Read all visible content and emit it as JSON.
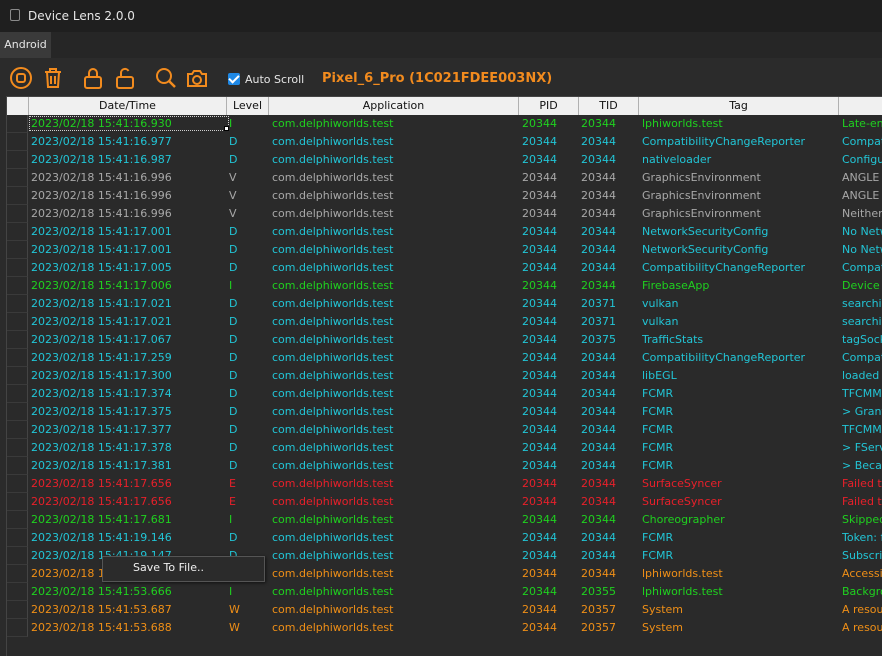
{
  "window": {
    "title": "Device Lens 2.0.0"
  },
  "tabs": [
    {
      "label": "Android"
    }
  ],
  "toolbar": {
    "icons": [
      "stop-icon",
      "trash-icon",
      "lock-icon",
      "unlock-icon",
      "search-icon",
      "camera-icon"
    ],
    "auto_scroll_label": "Auto Scroll",
    "auto_scroll_checked": true,
    "device_label": "Pixel_6_Pro (1C021FDEE003NX)"
  },
  "colors": {
    "I": "#1fd11f",
    "D": "#22c5d6",
    "V": "#a8a8a8",
    "E": "#e8202a",
    "W": "#ef8f17",
    "accent": "#f28b1e"
  },
  "table": {
    "columns": [
      "Date/Time",
      "Level",
      "Application",
      "PID",
      "TID",
      "Tag"
    ],
    "rows": [
      {
        "datetime": "2023/02/18 15:41:16.930",
        "level": "I",
        "app": "com.delphiworlds.test",
        "pid": "20344",
        "tid": "20344",
        "tag": "lphiworlds.test",
        "msg": "Late-en"
      },
      {
        "datetime": "2023/02/18 15:41:16.977",
        "level": "D",
        "app": "com.delphiworlds.test",
        "pid": "20344",
        "tid": "20344",
        "tag": "CompatibilityChangeReporter",
        "msg": "Compat"
      },
      {
        "datetime": "2023/02/18 15:41:16.987",
        "level": "D",
        "app": "com.delphiworlds.test",
        "pid": "20344",
        "tid": "20344",
        "tag": "nativeloader",
        "msg": "Configu"
      },
      {
        "datetime": "2023/02/18 15:41:16.996",
        "level": "V",
        "app": "com.delphiworlds.test",
        "pid": "20344",
        "tid": "20344",
        "tag": "GraphicsEnvironment",
        "msg": "ANGLE"
      },
      {
        "datetime": "2023/02/18 15:41:16.996",
        "level": "V",
        "app": "com.delphiworlds.test",
        "pid": "20344",
        "tid": "20344",
        "tag": "GraphicsEnvironment",
        "msg": "ANGLE"
      },
      {
        "datetime": "2023/02/18 15:41:16.996",
        "level": "V",
        "app": "com.delphiworlds.test",
        "pid": "20344",
        "tid": "20344",
        "tag": "GraphicsEnvironment",
        "msg": "Neither"
      },
      {
        "datetime": "2023/02/18 15:41:17.001",
        "level": "D",
        "app": "com.delphiworlds.test",
        "pid": "20344",
        "tid": "20344",
        "tag": "NetworkSecurityConfig",
        "msg": "No Netw"
      },
      {
        "datetime": "2023/02/18 15:41:17.001",
        "level": "D",
        "app": "com.delphiworlds.test",
        "pid": "20344",
        "tid": "20344",
        "tag": "NetworkSecurityConfig",
        "msg": "No Netw"
      },
      {
        "datetime": "2023/02/18 15:41:17.005",
        "level": "D",
        "app": "com.delphiworlds.test",
        "pid": "20344",
        "tid": "20344",
        "tag": "CompatibilityChangeReporter",
        "msg": "Compat"
      },
      {
        "datetime": "2023/02/18 15:41:17.006",
        "level": "I",
        "app": "com.delphiworlds.test",
        "pid": "20344",
        "tid": "20344",
        "tag": "FirebaseApp",
        "msg": "Device u"
      },
      {
        "datetime": "2023/02/18 15:41:17.021",
        "level": "D",
        "app": "com.delphiworlds.test",
        "pid": "20344",
        "tid": "20371",
        "tag": "vulkan",
        "msg": "searchin"
      },
      {
        "datetime": "2023/02/18 15:41:17.021",
        "level": "D",
        "app": "com.delphiworlds.test",
        "pid": "20344",
        "tid": "20371",
        "tag": "vulkan",
        "msg": "searchin"
      },
      {
        "datetime": "2023/02/18 15:41:17.067",
        "level": "D",
        "app": "com.delphiworlds.test",
        "pid": "20344",
        "tid": "20375",
        "tag": "TrafficStats",
        "msg": "tagSock"
      },
      {
        "datetime": "2023/02/18 15:41:17.259",
        "level": "D",
        "app": "com.delphiworlds.test",
        "pid": "20344",
        "tid": "20344",
        "tag": "CompatibilityChangeReporter",
        "msg": "Compat"
      },
      {
        "datetime": "2023/02/18 15:41:17.300",
        "level": "D",
        "app": "com.delphiworlds.test",
        "pid": "20344",
        "tid": "20344",
        "tag": "libEGL",
        "msg": "loaded /"
      },
      {
        "datetime": "2023/02/18 15:41:17.374",
        "level": "D",
        "app": "com.delphiworlds.test",
        "pid": "20344",
        "tid": "20344",
        "tag": "FCMR",
        "msg": "TFCMM"
      },
      {
        "datetime": "2023/02/18 15:41:17.375",
        "level": "D",
        "app": "com.delphiworlds.test",
        "pid": "20344",
        "tid": "20344",
        "tag": "FCMR",
        "msg": "> Grant"
      },
      {
        "datetime": "2023/02/18 15:41:17.377",
        "level": "D",
        "app": "com.delphiworlds.test",
        "pid": "20344",
        "tid": "20344",
        "tag": "FCMR",
        "msg": "TFCMM"
      },
      {
        "datetime": "2023/02/18 15:41:17.378",
        "level": "D",
        "app": "com.delphiworlds.test",
        "pid": "20344",
        "tid": "20344",
        "tag": "FCMR",
        "msg": "> FServi"
      },
      {
        "datetime": "2023/02/18 15:41:17.381",
        "level": "D",
        "app": "com.delphiworlds.test",
        "pid": "20344",
        "tid": "20344",
        "tag": "FCMR",
        "msg": "> Becar"
      },
      {
        "datetime": "2023/02/18 15:41:17.656",
        "level": "E",
        "app": "com.delphiworlds.test",
        "pid": "20344",
        "tid": "20344",
        "tag": "SurfaceSyncer",
        "msg": "Failed to"
      },
      {
        "datetime": "2023/02/18 15:41:17.656",
        "level": "E",
        "app": "com.delphiworlds.test",
        "pid": "20344",
        "tid": "20344",
        "tag": "SurfaceSyncer",
        "msg": "Failed to"
      },
      {
        "datetime": "2023/02/18 15:41:17.681",
        "level": "I",
        "app": "com.delphiworlds.test",
        "pid": "20344",
        "tid": "20344",
        "tag": "Choreographer",
        "msg": "Skipped"
      },
      {
        "datetime": "2023/02/18 15:41:19.146",
        "level": "D",
        "app": "com.delphiworlds.test",
        "pid": "20344",
        "tid": "20344",
        "tag": "FCMR",
        "msg": "Token: f"
      },
      {
        "datetime": "2023/02/18 15:41:19.147",
        "level": "D",
        "app": "com.delphiworlds.test",
        "pid": "20344",
        "tid": "20344",
        "tag": "FCMR",
        "msg": "Subscrib"
      },
      {
        "datetime": "2023/02/18 15:41:53.",
        "level": "",
        "app": "com.delphiworlds.test",
        "pid": "20344",
        "tid": "20344",
        "tag": "lphiworlds.test",
        "msg": "Accessi"
      },
      {
        "datetime": "2023/02/18 15:41:53.666",
        "level": "I",
        "app": "com.delphiworlds.test",
        "pid": "20344",
        "tid": "20355",
        "tag": "lphiworlds.test",
        "msg": "Backgro"
      },
      {
        "datetime": "2023/02/18 15:41:53.687",
        "level": "W",
        "app": "com.delphiworlds.test",
        "pid": "20344",
        "tid": "20357",
        "tag": "System",
        "msg": "A resou"
      },
      {
        "datetime": "2023/02/18 15:41:53.688",
        "level": "W",
        "app": "com.delphiworlds.test",
        "pid": "20344",
        "tid": "20357",
        "tag": "System",
        "msg": "A resou"
      }
    ],
    "row_levels_color": [
      "I",
      "D",
      "D",
      "V",
      "V",
      "V",
      "D",
      "D",
      "D",
      "I",
      "D",
      "D",
      "D",
      "D",
      "D",
      "D",
      "D",
      "D",
      "D",
      "D",
      "E",
      "E",
      "I",
      "D",
      "D",
      "W",
      "I",
      "W",
      "W"
    ]
  },
  "context_menu": {
    "items": [
      "Save To File.."
    ]
  }
}
